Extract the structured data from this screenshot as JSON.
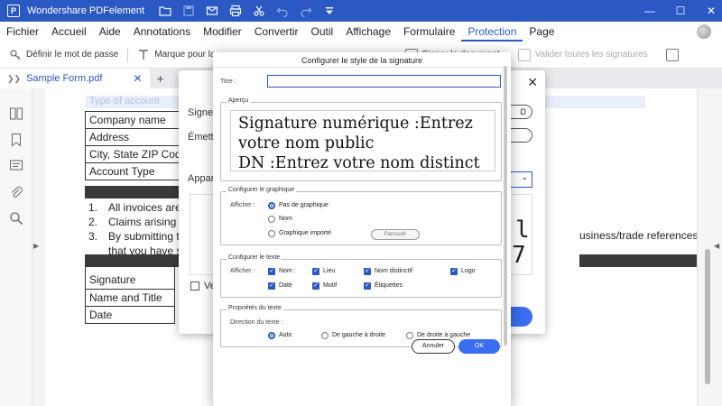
{
  "app": {
    "title": "Wondershare PDFelement",
    "logo_letter": "P"
  },
  "window_controls": {
    "minimize": "—",
    "maximize": "☐",
    "close": "✕"
  },
  "menu": [
    {
      "label": "Fichier"
    },
    {
      "label": "Accueil"
    },
    {
      "label": "Aide"
    },
    {
      "label": "Annotations"
    },
    {
      "label": "Modifier"
    },
    {
      "label": "Convertir"
    },
    {
      "label": "Outil"
    },
    {
      "label": "Affichage"
    },
    {
      "label": "Formulaire"
    },
    {
      "label": "Protection",
      "active": true
    },
    {
      "label": "Page"
    }
  ],
  "toolbar": {
    "set_password": "Définir le mot de passe",
    "mark_for_redaction": "Marque pour la",
    "sign_document": "Signer le document",
    "validate_signatures": "Valider toutes les signatures"
  },
  "tab": {
    "name": "Sample Form.pdf",
    "close": "✕",
    "new_tab": "+"
  },
  "document": {
    "ghost_header": "Type of account",
    "form_rows": [
      "Company name",
      "Address",
      "City, State ZIP Code",
      "Account Type"
    ],
    "list": [
      {
        "num": "1.",
        "text": "All invoices are t"
      },
      {
        "num": "2.",
        "text": "Claims arising fro"
      },
      {
        "num": "3.",
        "text": "By submitting thi"
      },
      {
        "num": "",
        "text": "that you have su"
      }
    ],
    "right_text": "usiness/trade references",
    "signature_rows": [
      "Signature",
      "Name and Title",
      "Date"
    ]
  },
  "bg_dialog": {
    "signer": "Signer",
    "emetteur": "Émette",
    "apparence": "Appare",
    "pill_1": "D",
    "pill_2": "",
    "close": "✕",
    "preview_chars": [
      "l",
      "7"
    ],
    "checkbox_label": "Ve"
  },
  "dialog": {
    "title": "Configurer le style de la signature",
    "title_label": "Titre :",
    "title_value": "",
    "apercu_label": "Aperçu",
    "preview_lines": [
      "Signature numérique :Entrez",
      "votre nom public",
      "DN :Entrez votre nom distinct"
    ],
    "graphic_group": "Configurer le graphique",
    "afficher": "Afficher :",
    "graphic_options": [
      {
        "label": "Pas de graphique",
        "selected": true
      },
      {
        "label": "Nom",
        "selected": false
      },
      {
        "label": "Graphique importé",
        "selected": false
      }
    ],
    "browse_button": "Parcourir",
    "text_group": "Configurer le texte",
    "text_options": [
      {
        "label": "Nom :",
        "checked": true
      },
      {
        "label": "Lieu",
        "checked": true
      },
      {
        "label": "Nom distinctif",
        "checked": true
      },
      {
        "label": "Logo",
        "checked": true
      },
      {
        "label": "Date",
        "checked": true
      },
      {
        "label": "Motif",
        "checked": true
      },
      {
        "label": "Étiquettes",
        "checked": true
      }
    ],
    "props_group": "Propriétés du texte",
    "direction_label": "Direction du texte :",
    "direction_options": [
      {
        "label": "Auto",
        "selected": true
      },
      {
        "label": "De gauche à droite",
        "selected": false
      },
      {
        "label": "De droite à gauche",
        "selected": false
      }
    ],
    "cancel_button": "Annuler",
    "ok_button": "OK"
  },
  "colors": {
    "accent": "#2b59c3",
    "button_blue": "#3a6df0"
  }
}
